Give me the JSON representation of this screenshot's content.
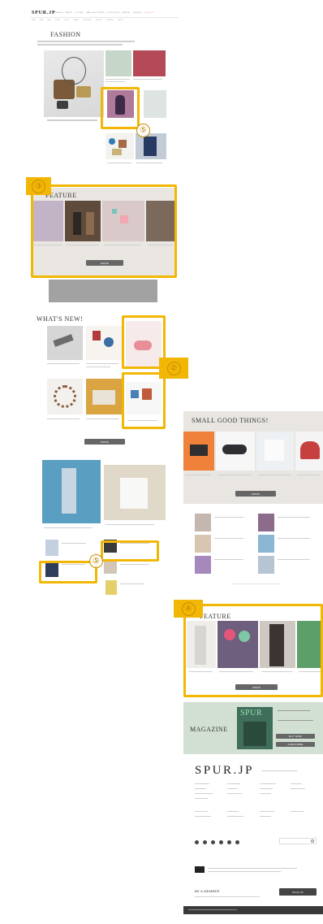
{
  "header": {
    "logo": "SPUR.JP",
    "nav": [
      "FASHION",
      "BEAUTY",
      "CULTURE",
      "SMALL GOOD THINGS",
      "COLLECTIONS",
      "FEATURE",
      "CELEBRITY",
      "MAGAZINE"
    ],
    "sub_nav": [
      "NEW",
      "WEB",
      "MAG",
      "EVENT",
      "SHOP",
      "BRAND",
      "SHOPPING",
      "PEOPLE",
      "PRESENT",
      "ABOUT"
    ]
  },
  "fashion": {
    "title": "FASHION"
  },
  "feature_1": {
    "title": "FEATURE",
    "more_label": "MORE"
  },
  "whats_new": {
    "title": "WHAT'S NEW!",
    "more_label": "MORE"
  },
  "small_good": {
    "title": "SMALL GOOD THINGS!",
    "more_label": "MORE"
  },
  "feature_2": {
    "title": "FEATURE",
    "more_label": "MORE"
  },
  "magazine": {
    "title": "MAGAZINE",
    "logo": "SPUR",
    "buy_label": "BUY NOW",
    "subscribe_label": "SUBSCRIBE"
  },
  "footer": {
    "logo": "SPUR.JP",
    "member_title": "BE A MEMBER",
    "member_button": "SIGN UP"
  },
  "callouts": [
    "③",
    "②",
    "⑤",
    "⑤",
    "④"
  ],
  "colors": {
    "highlight": "#f2b705",
    "callout_text": "#b87d00",
    "button": "#666666"
  }
}
